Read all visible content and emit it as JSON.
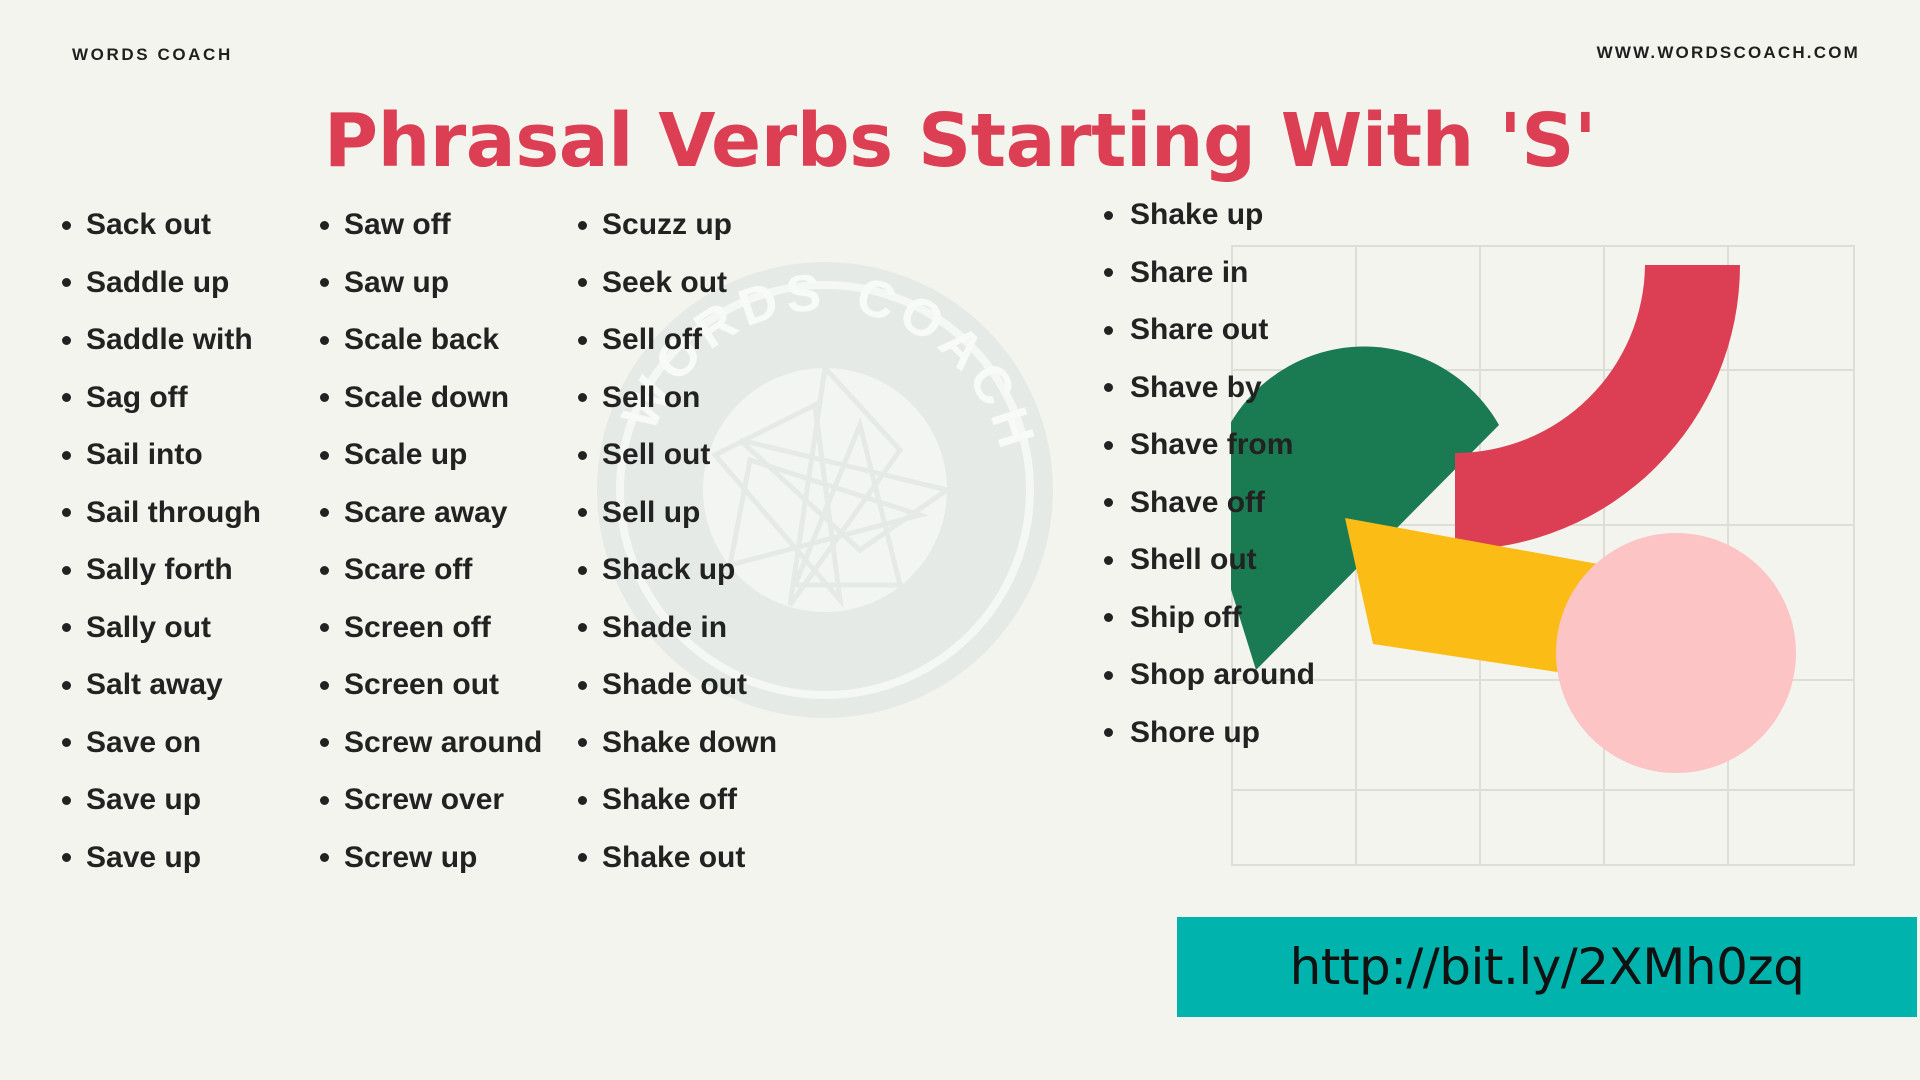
{
  "header": {
    "brand": "WORDS COACH",
    "site_url": "WWW.WORDSCOACH.COM",
    "title": "Phrasal Verbs Starting With 'S'"
  },
  "watermark": {
    "text_top": "WORDS",
    "text_bottom": "COACH",
    "icon": "camera-aperture-icon"
  },
  "columns": [
    {
      "id": "column-1",
      "items": [
        "Sack out",
        "Saddle up",
        "Saddle with",
        "Sag off",
        "Sail into",
        "Sail through",
        "Sally forth",
        "Sally out",
        "Salt away",
        "Save on",
        "Save up",
        "Save up"
      ]
    },
    {
      "id": "column-2",
      "items": [
        "Saw off",
        "Saw up",
        "Scale back",
        "Scale down",
        "Scale up",
        "Scare away",
        "Scare off",
        "Screen off",
        "Screen out",
        "Screw around",
        "Screw over",
        "Screw up"
      ]
    },
    {
      "id": "column-3",
      "items": [
        "Scuzz up",
        "Seek out",
        "Sell off",
        "Sell on",
        "Sell out",
        "Sell up",
        "Shack up",
        "Shade in",
        "Shade out",
        "Shake down",
        "Shake off",
        "Shake out"
      ]
    },
    {
      "id": "column-4",
      "items": [
        "Shake up",
        "Share in",
        "Share out",
        "Shave by",
        "Shave from",
        "Shave off",
        "Shell out",
        "Ship off",
        "Shop around",
        "Shore up"
      ]
    }
  ],
  "decoration": {
    "grid_label": "decorative-grid",
    "shapes": [
      {
        "name": "green-half-disc",
        "color": "#1A7A52"
      },
      {
        "name": "red-quarter-arc",
        "color": "#DC3F53"
      },
      {
        "name": "yellow-bar",
        "color": "#FBBC16"
      },
      {
        "name": "pink-circle",
        "color": "#FCC4C4"
      }
    ],
    "grid_line_color": "#DEDED6"
  },
  "url_banner": {
    "text": "http://bit.ly/2XMh0zq",
    "background": "#00B3AC"
  },
  "colors": {
    "page_background": "#F4F4EE",
    "title_red": "#DC3F53",
    "text_dark": "#222222",
    "teal": "#00B3AC"
  }
}
